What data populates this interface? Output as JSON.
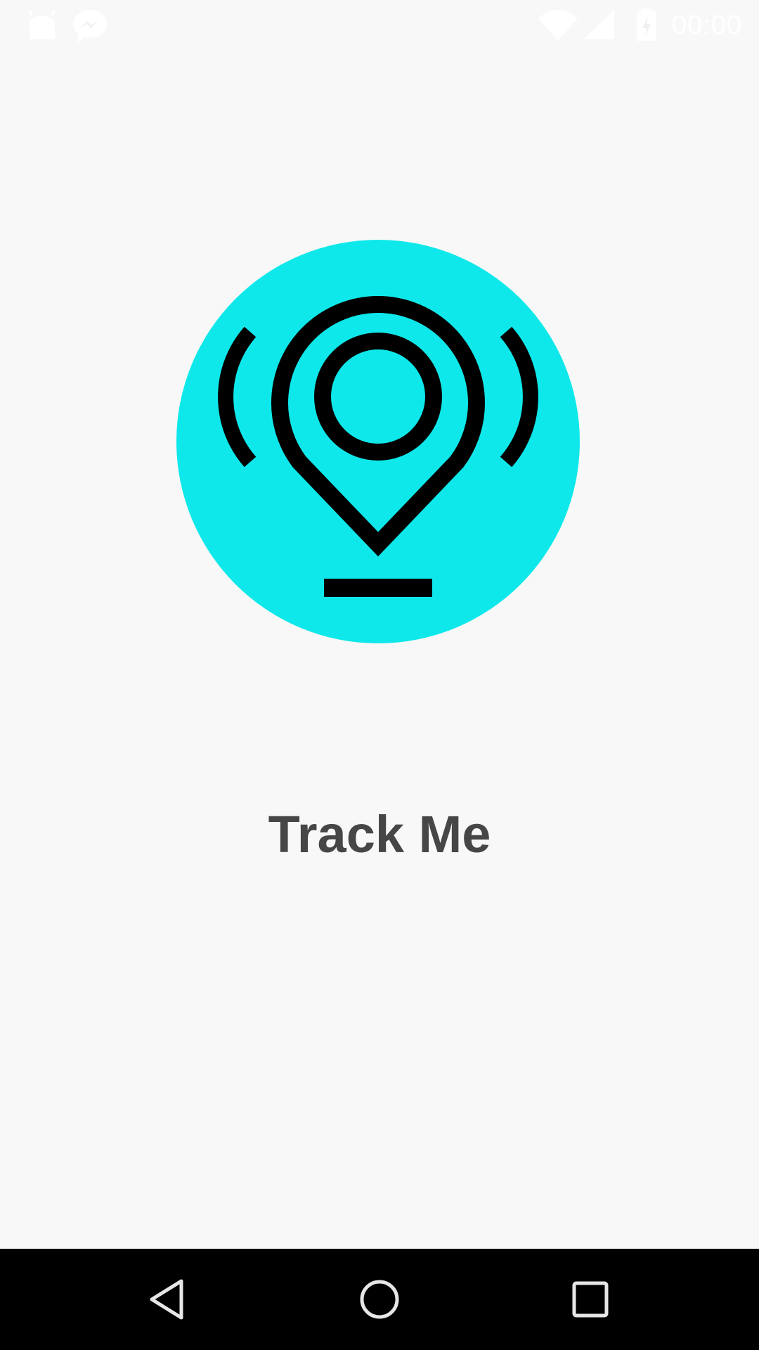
{
  "status_bar": {
    "time": "00:00",
    "notification_icons": [
      "android-icon",
      "messenger-icon"
    ],
    "system_icons": [
      "wifi-icon",
      "cell-signal-icon",
      "battery-charging-icon"
    ]
  },
  "app": {
    "title": "Track Me",
    "logo_icon": "location-pin-signal-icon",
    "colors": {
      "logo_background": "#0fe8ea",
      "logo_stroke": "#000000",
      "title_text": "#464646",
      "page_background": "#f8f8f8"
    }
  },
  "nav_bar": {
    "buttons": [
      "back-icon",
      "home-icon",
      "recents-icon"
    ]
  }
}
